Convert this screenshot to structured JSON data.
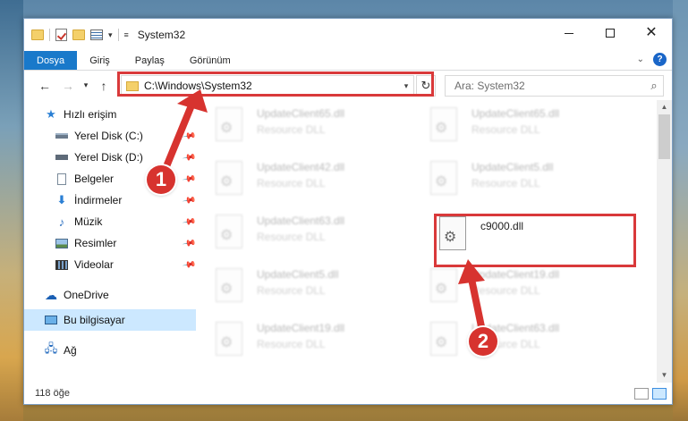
{
  "window": {
    "title": "System32",
    "controls": {
      "minimize": "",
      "maximize": "",
      "close": "✕"
    }
  },
  "ribbon": {
    "tabs": [
      "Dosya",
      "Giriş",
      "Paylaş",
      "Görünüm"
    ],
    "help": "?"
  },
  "address": {
    "path": "C:\\Windows\\System32",
    "search_placeholder": "Ara: System32"
  },
  "sidebar": {
    "quick_access": "Hızlı erişim",
    "items": [
      {
        "label": "Yerel Disk (C:)",
        "icon": "drive-icon",
        "pinned": true
      },
      {
        "label": "Yerel Disk (D:)",
        "icon": "drive-icon",
        "pinned": true
      },
      {
        "label": "Belgeler",
        "icon": "documents-icon",
        "pinned": true
      },
      {
        "label": "İndirmeler",
        "icon": "download-icon",
        "pinned": true
      },
      {
        "label": "Müzik",
        "icon": "music-icon",
        "pinned": true
      },
      {
        "label": "Resimler",
        "icon": "pictures-icon",
        "pinned": true
      },
      {
        "label": "Videolar",
        "icon": "videos-icon",
        "pinned": true
      }
    ],
    "onedrive": "OneDrive",
    "this_pc": "Bu bilgisayar",
    "network": "Ağ"
  },
  "files": {
    "left_column": [
      {
        "name": "UpdateClient65.dll",
        "type": "Resource DLL"
      },
      {
        "name": "UpdateClient42.dll",
        "type": "Resource DLL"
      },
      {
        "name": "UpdateClient63.dll",
        "type": "Resource DLL"
      },
      {
        "name": "UpdateClient5.dll",
        "type": "Resource DLL"
      },
      {
        "name": "UpdateClient19.dll",
        "type": "Resource DLL"
      }
    ],
    "right_column": [
      {
        "name": "UpdateClient65.dll",
        "type": "Resource DLL"
      },
      {
        "name": "UpdateClient5.dll",
        "type": "Resource DLL"
      },
      {
        "name": "c9000.dll",
        "type": ""
      },
      {
        "name": "UpdateClient19.dll",
        "type": "Resource DLL"
      },
      {
        "name": "UpdateClient63.dll",
        "type": "Resource DLL"
      }
    ]
  },
  "status": {
    "item_count": "118 öğe"
  },
  "callouts": {
    "one": "1",
    "two": "2"
  },
  "colors": {
    "accent": "#1979ca",
    "highlight": "#d9393a",
    "selection": "#cce8ff"
  }
}
